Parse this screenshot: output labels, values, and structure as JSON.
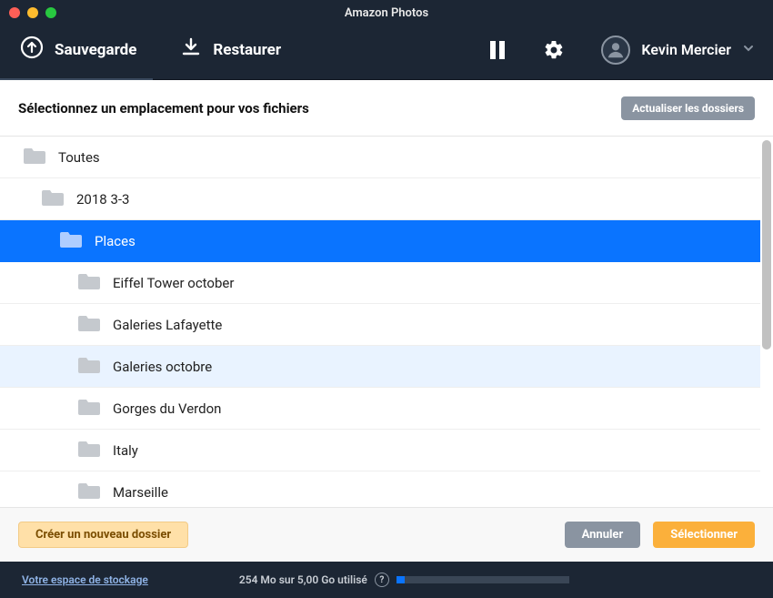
{
  "window": {
    "title": "Amazon Photos"
  },
  "toolbar": {
    "backup_label": "Sauvegarde",
    "restore_label": "Restaurer",
    "user_name": "Kevin Mercier"
  },
  "selector": {
    "title": "Sélectionnez un emplacement pour vos fichiers",
    "refresh_label": "Actualiser les dossiers"
  },
  "tree": {
    "items": [
      {
        "label": "Toutes",
        "indent": 0,
        "state": "normal"
      },
      {
        "label": "2018 3-3",
        "indent": 1,
        "state": "normal"
      },
      {
        "label": "Places",
        "indent": 2,
        "state": "selected"
      },
      {
        "label": "Eiffel Tower october",
        "indent": 3,
        "state": "normal"
      },
      {
        "label": "Galeries Lafayette",
        "indent": 3,
        "state": "normal"
      },
      {
        "label": "Galeries octobre",
        "indent": 3,
        "state": "hovered"
      },
      {
        "label": "Gorges du Verdon",
        "indent": 3,
        "state": "normal"
      },
      {
        "label": "Italy",
        "indent": 3,
        "state": "normal"
      },
      {
        "label": "Marseille",
        "indent": 3,
        "state": "normal"
      }
    ]
  },
  "actions": {
    "new_folder": "Créer un nouveau dossier",
    "cancel": "Annuler",
    "select": "Sélectionner"
  },
  "footer": {
    "storage_link": "Votre espace de stockage",
    "usage_text": "254 Mo sur 5,00 Go utilisé",
    "usage_percent": 5
  }
}
